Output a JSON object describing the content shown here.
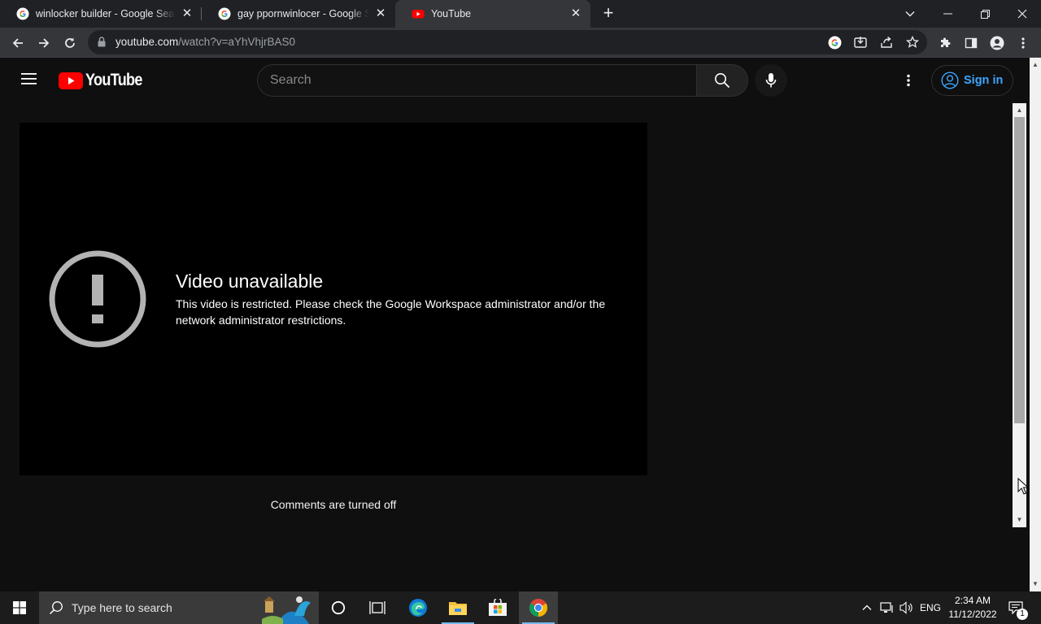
{
  "browser": {
    "tabs": [
      {
        "title": "winlocker builder - Google Search",
        "favicon": "google-favicon",
        "active": false
      },
      {
        "title": "gay ppornwinlocer - Google Search",
        "favicon": "google-favicon",
        "active": false
      },
      {
        "title": "YouTube",
        "favicon": "youtube-favicon",
        "active": true
      }
    ],
    "url_host": "youtube.com",
    "url_path": "/watch?v=aYhVhjrBAS0"
  },
  "youtube": {
    "logo_text": "YouTube",
    "search_placeholder": "Search",
    "signin_label": "Sign in",
    "error_title": "Video unavailable",
    "error_message": "This video is restricted. Please check the Google Workspace administrator and/or the network administrator restrictions.",
    "comments_status": "Comments are turned off",
    "brand_red": "#ff0000",
    "link_blue": "#3ea6ff"
  },
  "taskbar": {
    "search_placeholder": "Type here to search",
    "language": "ENG",
    "time": "2:34 AM",
    "date": "11/12/2022",
    "notification_count": "1"
  }
}
